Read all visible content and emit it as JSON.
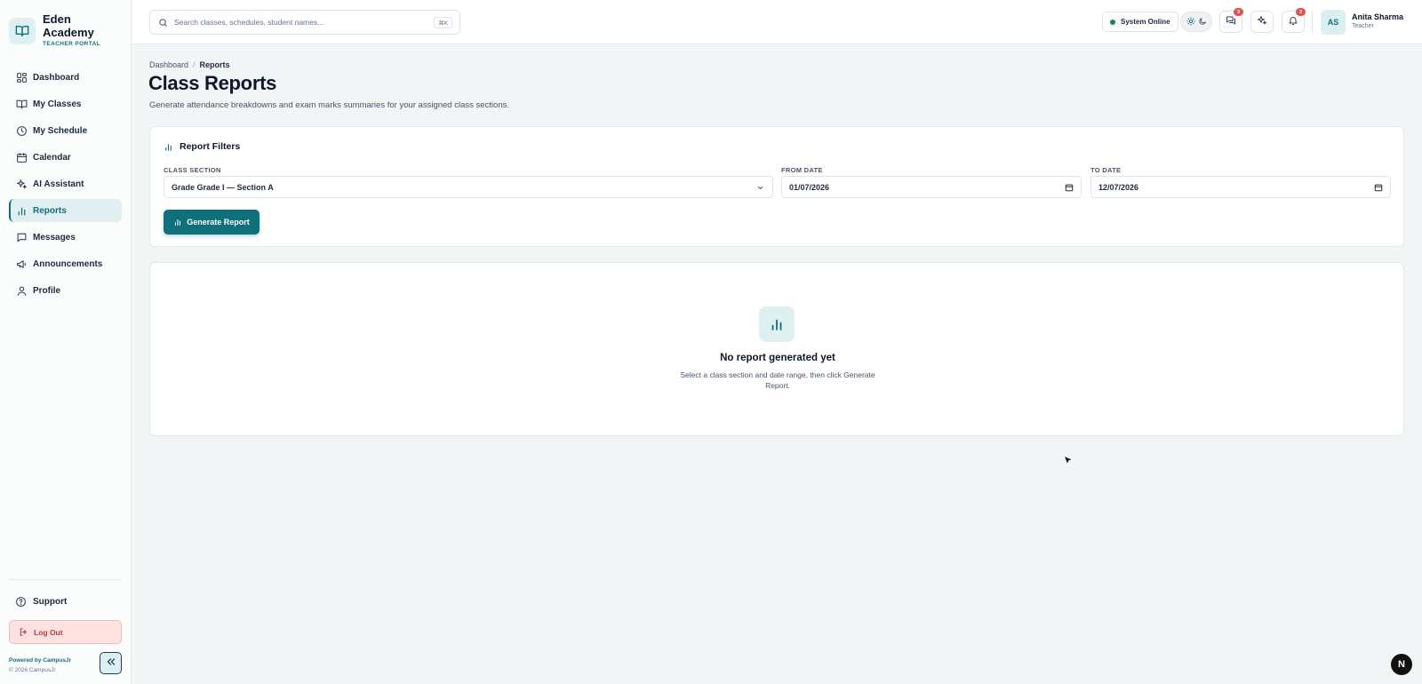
{
  "brand": {
    "name": "Eden Academy",
    "subtitle": "TEACHER PORTAL"
  },
  "sidebar": {
    "items": [
      {
        "label": "Dashboard",
        "icon": "dashboard-icon"
      },
      {
        "label": "My Classes",
        "icon": "book-icon"
      },
      {
        "label": "My Schedule",
        "icon": "clock-icon"
      },
      {
        "label": "Calendar",
        "icon": "calendar-icon"
      },
      {
        "label": "AI Assistant",
        "icon": "sparkles-icon"
      },
      {
        "label": "Reports",
        "icon": "bar-chart-icon",
        "active": true
      },
      {
        "label": "Messages",
        "icon": "message-icon"
      },
      {
        "label": "Announcements",
        "icon": "megaphone-icon"
      },
      {
        "label": "Profile",
        "icon": "user-icon"
      }
    ],
    "support_label": "Support",
    "logout_label": "Log Out",
    "powered_by": "Powered by CampusJr",
    "copyright": "© 2026 CampusJr"
  },
  "topbar": {
    "search_placeholder": "Search classes, schedules, student names...",
    "search_shortcut": "⌘K",
    "status_label": "System Online",
    "messages_badge": "3",
    "notifications_badge": "3",
    "user": {
      "initials": "AS",
      "name": "Anita Sharma",
      "role": "Teacher"
    }
  },
  "breadcrumb": {
    "parent": "Dashboard",
    "separator": "/",
    "current": "Reports"
  },
  "page": {
    "title": "Class Reports",
    "description": "Generate attendance breakdowns and exam marks summaries for your assigned class sections."
  },
  "filters": {
    "title": "Report Filters",
    "class_section_label": "CLASS SECTION",
    "class_section_value": "Grade Grade I — Section A",
    "from_date_label": "FROM DATE",
    "from_date_value": "01/07/2026",
    "to_date_label": "TO DATE",
    "to_date_value": "12/07/2026",
    "generate_label": "Generate Report"
  },
  "empty_state": {
    "title": "No report generated yet",
    "description": "Select a class section and date range, then click Generate Report."
  },
  "colors": {
    "accent": "#0f6f7a",
    "accent_light": "#dff0f1",
    "danger": "#e05252",
    "online": "#16855a"
  },
  "dev_badge": "N"
}
